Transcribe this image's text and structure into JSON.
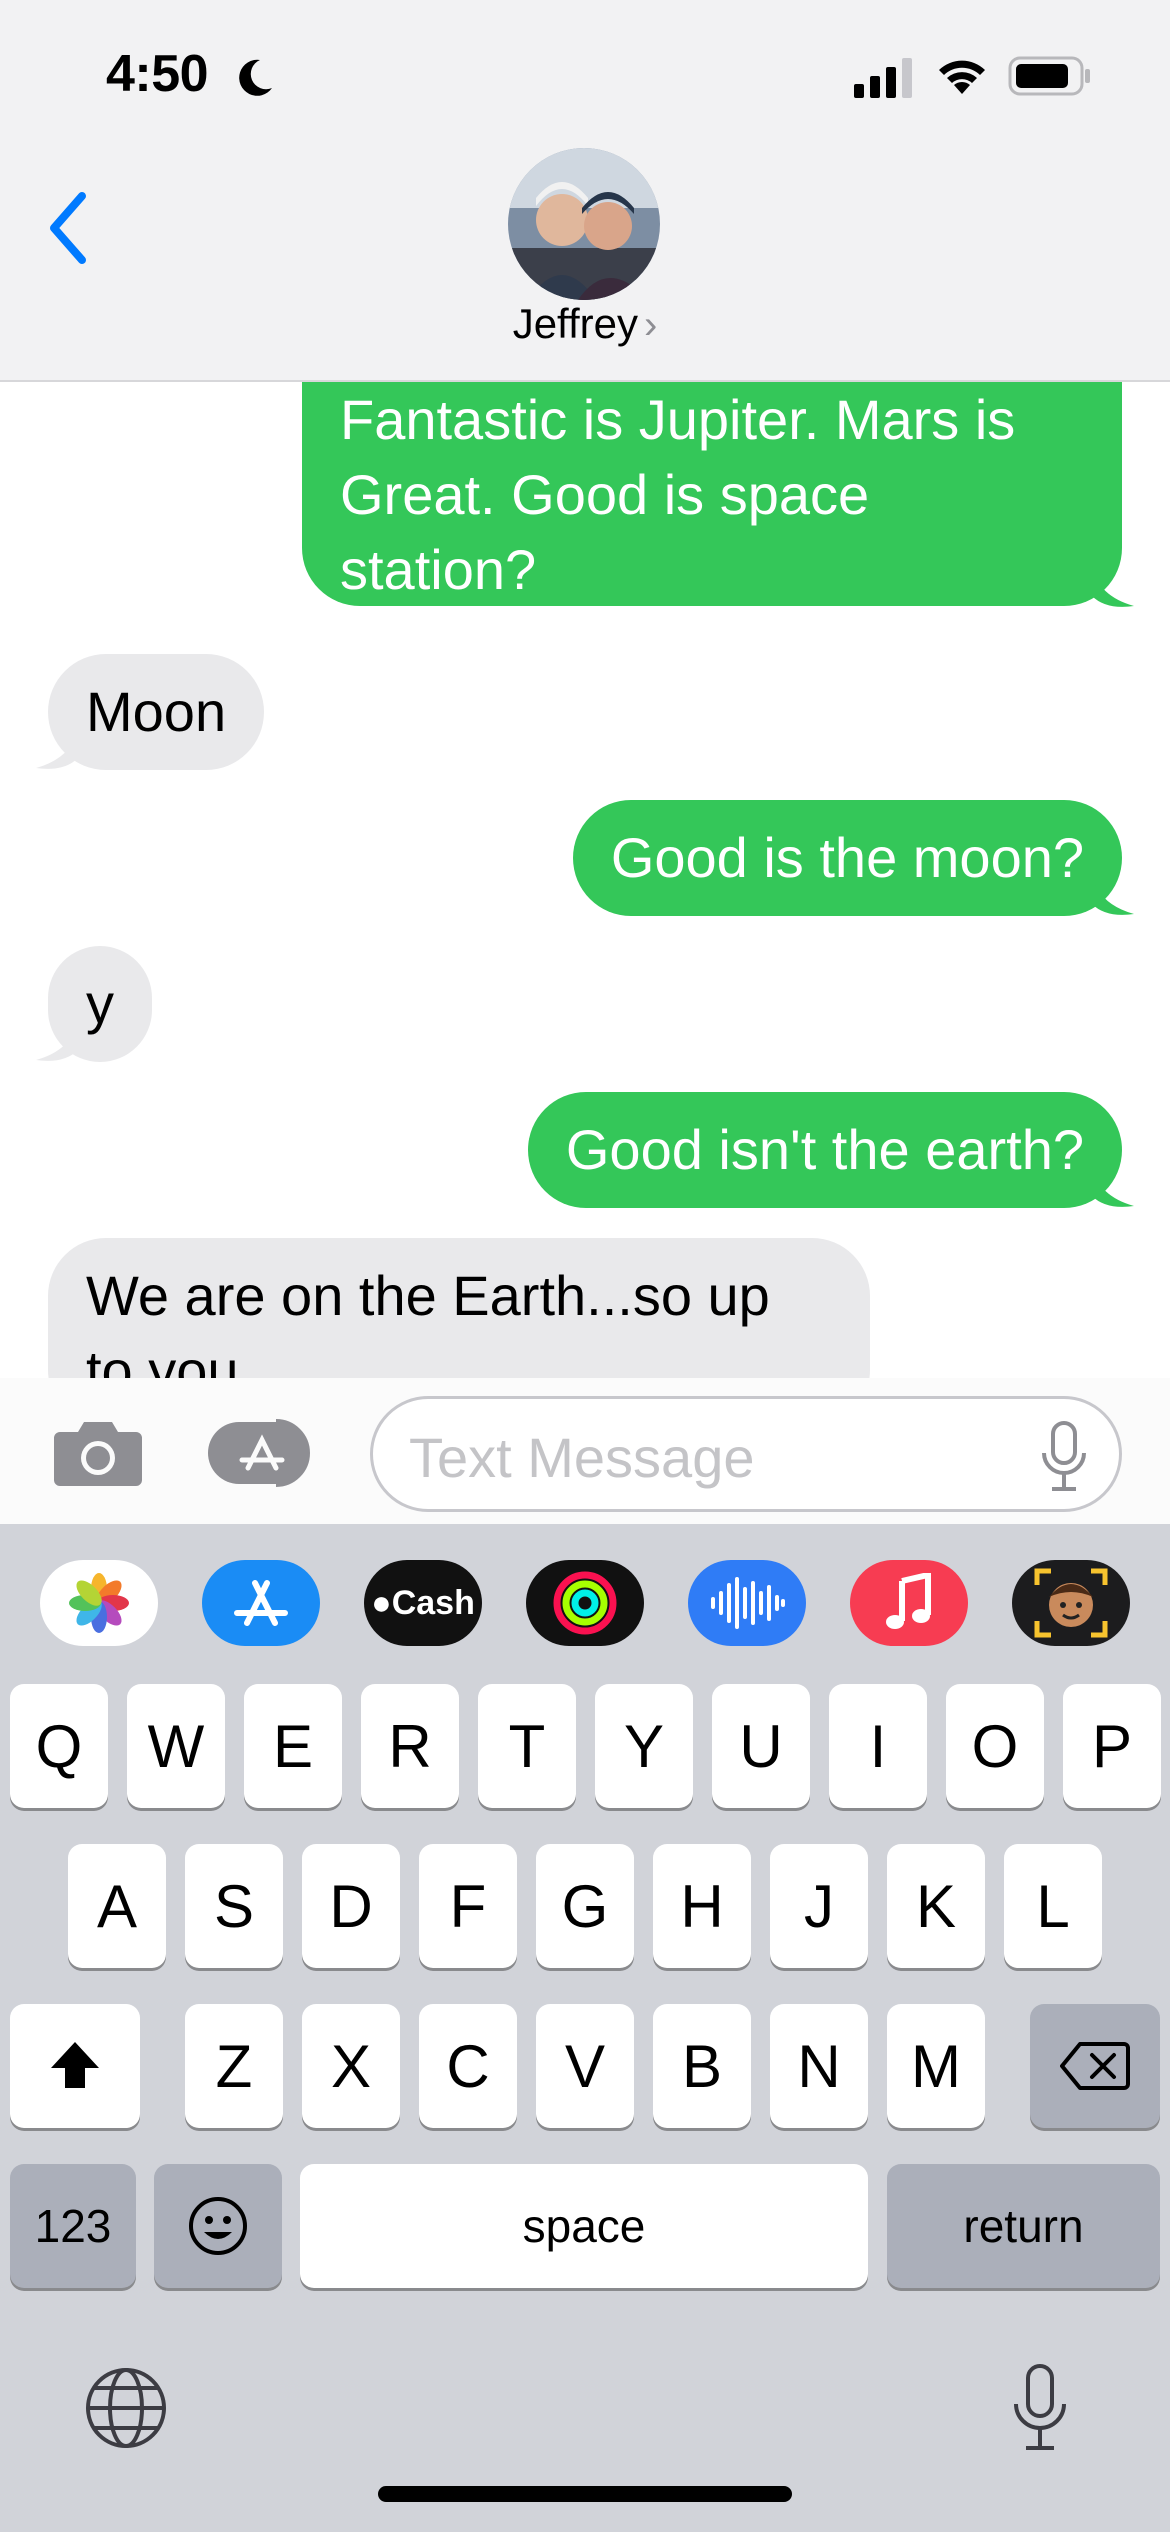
{
  "status_bar": {
    "time": "4:50",
    "focus_icon": "moon-icon",
    "signal_icon": "cellular-signal-icon",
    "wifi_icon": "wifi-icon",
    "battery_icon": "battery-icon"
  },
  "header": {
    "contact_name": "Jeffrey",
    "chevron": "›",
    "back_icon": "chevron-left-icon"
  },
  "messages": [
    {
      "direction": "outgoing",
      "text_lines": [
        "Fantastic is Jupiter. Mars is",
        "Great. Good is space",
        "station?"
      ]
    },
    {
      "direction": "incoming",
      "text": "Moon"
    },
    {
      "direction": "outgoing",
      "text": "Good is the moon?"
    },
    {
      "direction": "incoming",
      "text": "y"
    },
    {
      "direction": "outgoing",
      "text": "Good isn't the earth?"
    },
    {
      "direction": "incoming",
      "text_lines": [
        "We are on the Earth...so up",
        "to you"
      ]
    }
  ],
  "input_bar": {
    "placeholder": "Text Message",
    "camera_icon": "camera-icon",
    "apps_icon": "app-store-icon",
    "mic_icon": "microphone-icon"
  },
  "app_strip": [
    {
      "name": "Photos",
      "icon": "photos-icon"
    },
    {
      "name": "App Store",
      "icon": "app-store-icon"
    },
    {
      "name": "Cash",
      "label": "Cash",
      "icon": "apple-cash-icon"
    },
    {
      "name": "Activity",
      "icon": "activity-rings-icon"
    },
    {
      "name": "Audio",
      "icon": "audio-waveform-icon"
    },
    {
      "name": "Music",
      "icon": "music-note-icon"
    },
    {
      "name": "Memoji",
      "icon": "memoji-icon"
    }
  ],
  "keyboard": {
    "row1": [
      "Q",
      "W",
      "E",
      "R",
      "T",
      "Y",
      "U",
      "I",
      "O",
      "P"
    ],
    "row2": [
      "A",
      "S",
      "D",
      "F",
      "G",
      "H",
      "J",
      "K",
      "L"
    ],
    "row3": [
      "Z",
      "X",
      "C",
      "V",
      "B",
      "N",
      "M"
    ],
    "numbers_label": "123",
    "space_label": "space",
    "return_label": "return",
    "shift_icon": "shift-icon",
    "delete_icon": "delete-icon",
    "emoji_icon": "emoji-icon",
    "globe_icon": "globe-icon",
    "dictation_icon": "microphone-icon"
  },
  "colors": {
    "outgoing": "#34c759",
    "incoming": "#e9e9eb",
    "accent": "#007aff",
    "keyboard_bg": "#d1d3d9"
  }
}
